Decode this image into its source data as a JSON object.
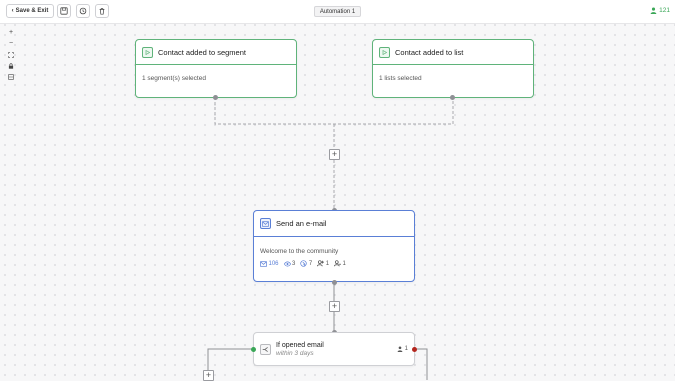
{
  "toolbar": {
    "save_exit_label": "Save & Exit",
    "title": "Automation 1",
    "users_count": "121"
  },
  "zoom_controls": [
    "zoom-in-icon",
    "zoom-out-icon",
    "fit-view-icon",
    "lock-icon",
    "map-icon"
  ],
  "nodes": {
    "trigger_segment": {
      "title": "Contact added to segment",
      "detail": "1 segment(s) selected"
    },
    "trigger_list": {
      "title": "Contact added to list",
      "detail": "1 lists selected"
    },
    "send_email": {
      "title": "Send an e-mail",
      "subject": "Welcome to the community",
      "stats": {
        "sent": "106",
        "opened": "3",
        "clicked": "7",
        "subscribed": "1",
        "unsubscribed": "1"
      }
    },
    "condition": {
      "title": "If opened email",
      "subtitle": "within 3 days",
      "count": "1"
    }
  },
  "colors": {
    "trigger": "#5fb37a",
    "action": "#5a7fd6",
    "yes_branch": "#3aa757",
    "no_branch": "#b3261e"
  }
}
